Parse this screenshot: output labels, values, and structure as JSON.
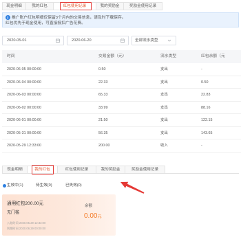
{
  "top_tabs": [
    {
      "label": "现金明细"
    },
    {
      "label": "我的红包"
    },
    {
      "label": "红包使用记录",
      "active": true
    },
    {
      "label": "我的奖励金"
    },
    {
      "label": "奖励金使用记录"
    }
  ],
  "notice": {
    "icon": "info-icon",
    "lines": [
      "推广账户红包明细仅保留3个月内的交易信息，请及时下载保存。",
      "红包优先于现金使用，可直接抵扣广告花费。"
    ]
  },
  "filters": {
    "start_date": {
      "value": "2020-05-01",
      "icon": "calendar-icon"
    },
    "end_date": {
      "value": "2020-06-20",
      "icon": "calendar-icon"
    },
    "flow_type": {
      "value": "全部流水类型",
      "icon": "chevron-down-icon"
    }
  },
  "history_table": {
    "columns": {
      "time": "时间",
      "amount": "交易金额（元）",
      "type": "流水类型",
      "balance": "红包余额（元"
    },
    "rows": [
      {
        "time": "2020-06-05 00:00:00",
        "amount": "0.50",
        "type": "支出",
        "balance": "-"
      },
      {
        "time": "2020-06-04 00:00:00",
        "amount": "22.33",
        "type": "支出",
        "balance": "0.50"
      },
      {
        "time": "2020-06-03 00:00:00",
        "amount": "65.33",
        "type": "支出",
        "balance": "22.83"
      },
      {
        "time": "2020-06-02 00:00:00",
        "amount": "33.99",
        "type": "支出",
        "balance": "88.16"
      },
      {
        "time": "2020-06-01 00:00:00",
        "amount": "21.50",
        "type": "支出",
        "balance": "122.15"
      },
      {
        "time": "2020-05-31 00:00:00",
        "amount": "56.35",
        "type": "支出",
        "balance": "143.65"
      },
      {
        "time": "2020-05-29 12:33:00",
        "amount": "200.00",
        "type": "收入",
        "balance": "-"
      }
    ]
  },
  "bottom_tabs": [
    {
      "label": "现金明细"
    },
    {
      "label": "我的红包",
      "active": true
    },
    {
      "label": "红包使用记录"
    },
    {
      "label": "我的奖励金"
    },
    {
      "label": "奖励金使用记录"
    }
  ],
  "status_filter": {
    "options": [
      {
        "label": "生效中(1)",
        "selected": true
      },
      {
        "label": "待生效(0)",
        "selected": false
      },
      {
        "label": "已失效(0)",
        "selected": false
      }
    ]
  },
  "coupon": {
    "title": "通用红包200.00元",
    "threshold": "无门槛",
    "credited_time": "入账时间 2020.05.29 12:33:00",
    "expire_time": "到期时间 2020.06.29 00:00:00",
    "balance_label": "余额",
    "balance_value": "0.00",
    "balance_unit": "元"
  },
  "colors": {
    "accent_blue": "#2d7fe0",
    "active_tab_text": "#e4572e",
    "annotation_red": "#e53935",
    "balance_orange": "#f47a26",
    "notice_background": "#e9f2fd",
    "coupon_background": "#fde8dc"
  }
}
